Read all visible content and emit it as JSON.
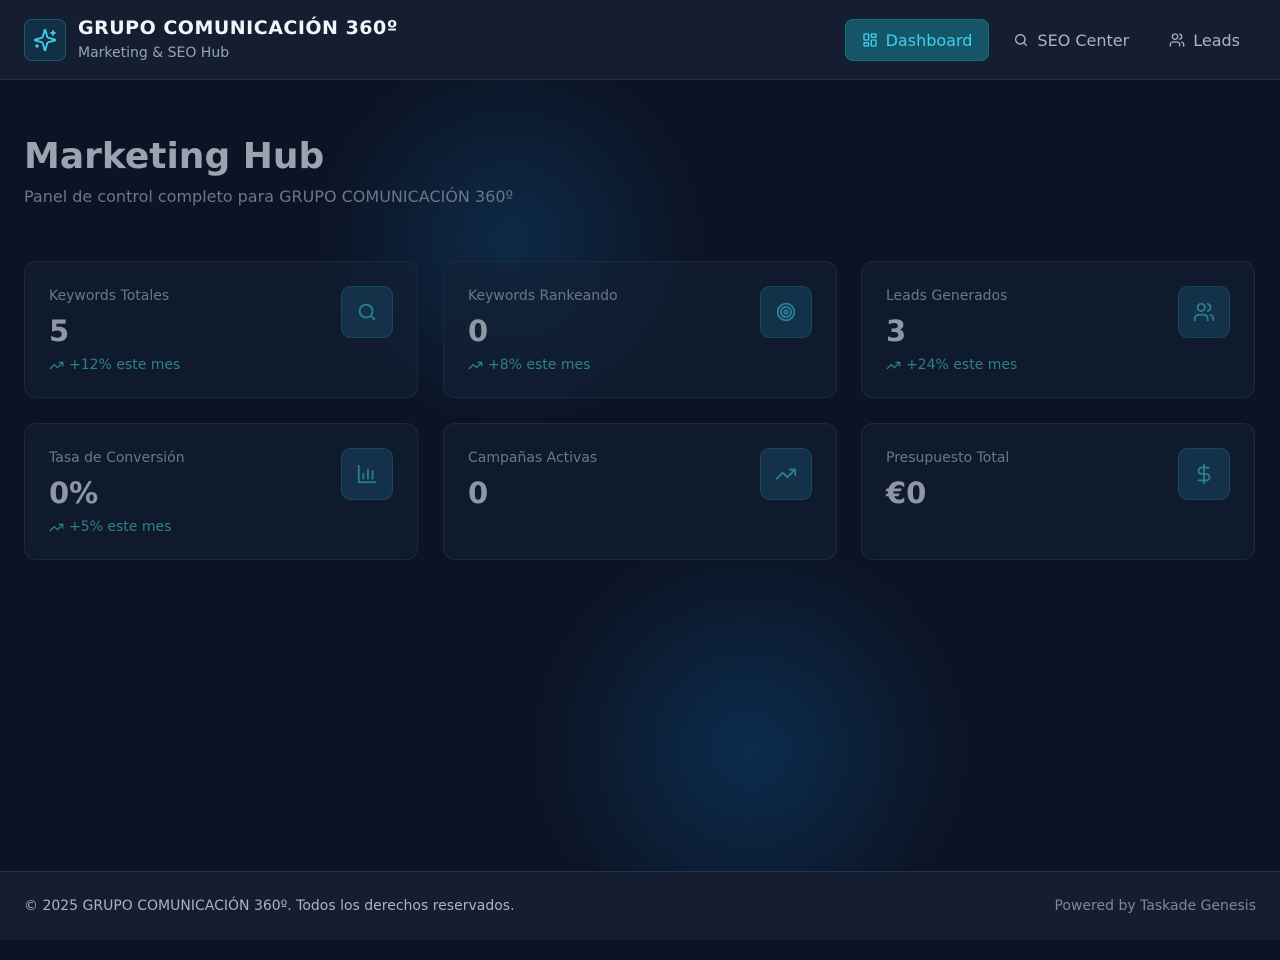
{
  "header": {
    "brand_title": "GRUPO COMUNICACIÓN 360º",
    "brand_subtitle": "Marketing & SEO Hub",
    "brand_icon": "sparkles-icon",
    "nav": [
      {
        "label": "Dashboard",
        "icon": "layout-grid-icon",
        "active": true
      },
      {
        "label": "SEO Center",
        "icon": "search-icon",
        "active": false
      },
      {
        "label": "Leads",
        "icon": "users-icon",
        "active": false
      }
    ]
  },
  "main": {
    "title": "Marketing Hub",
    "subtitle": "Panel de control completo para GRUPO COMUNICACIÓN 360º",
    "cards": [
      {
        "label": "Keywords Totales",
        "value": "5",
        "trend": "+12% este mes",
        "icon": "search-icon"
      },
      {
        "label": "Keywords Rankeando",
        "value": "0",
        "trend": "+8% este mes",
        "icon": "target-icon"
      },
      {
        "label": "Leads Generados",
        "value": "3",
        "trend": "+24% este mes",
        "icon": "users-icon"
      },
      {
        "label": "Tasa de Conversión",
        "value": "0%",
        "trend": "+5% este mes",
        "icon": "bar-chart-icon"
      },
      {
        "label": "Campañas Activas",
        "value": "0",
        "trend": "",
        "icon": "trending-up-icon"
      },
      {
        "label": "Presupuesto Total",
        "value": "€0",
        "trend": "",
        "icon": "dollar-sign-icon"
      }
    ]
  },
  "footer": {
    "copyright": "© 2025 GRUPO COMUNICACIÓN 360º. Todos los derechos reservados.",
    "powered_by": "Powered by Taskade Genesis"
  },
  "colors": {
    "accent": "#3fd1ea",
    "background": "#0c1324",
    "header_bg": "#151d30",
    "trend": "#2f7f8a"
  }
}
